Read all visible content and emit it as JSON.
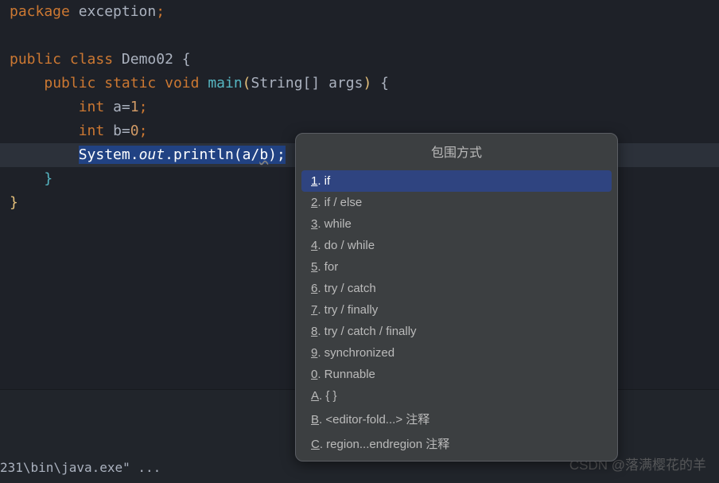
{
  "code": {
    "line1": {
      "package": "package",
      "name": "exception"
    },
    "line3": {
      "public": "public",
      "class": "class",
      "name": "Demo02",
      "brace": "{"
    },
    "line4": {
      "public": "public",
      "static": "static",
      "void": "void",
      "main": "main",
      "lparen": "(",
      "string": "String",
      "brackets": "[]",
      "args": "args",
      "rparen": ")",
      "brace": "{"
    },
    "line5": {
      "int": "int",
      "var": "a",
      "eq": "=",
      "val": "1"
    },
    "line6": {
      "int": "int",
      "var": "b",
      "eq": "=",
      "val": "0"
    },
    "line7": {
      "system": "System",
      "dot1": ".",
      "out": "out",
      "dot2": ".",
      "println": "println",
      "lp": "(",
      "a": "a",
      "slash": "/",
      "b": "b",
      "rp": ")",
      "semi": ";"
    },
    "line8": {
      "brace": "}"
    },
    "line9": {
      "brace": "}"
    }
  },
  "popup": {
    "title": "包围方式",
    "items": [
      {
        "num": "1",
        "label": ". if"
      },
      {
        "num": "2",
        "label": ". if / else"
      },
      {
        "num": "3",
        "label": ". while"
      },
      {
        "num": "4",
        "label": ". do / while"
      },
      {
        "num": "5",
        "label": ". for"
      },
      {
        "num": "6",
        "label": ". try / catch"
      },
      {
        "num": "7",
        "label": ". try / finally"
      },
      {
        "num": "8",
        "label": ". try / catch / finally"
      },
      {
        "num": "9",
        "label": ". synchronized"
      },
      {
        "num": "0",
        "label": ". Runnable"
      },
      {
        "num": "A",
        "label": ". { }"
      },
      {
        "num": "B",
        "label": ". <editor-fold...> 注释"
      },
      {
        "num": "C",
        "label": ". region...endregion 注释"
      }
    ]
  },
  "bottom": {
    "text": "231\\bin\\java.exe\" ..."
  },
  "watermark": "CSDN @落满樱花的羊"
}
